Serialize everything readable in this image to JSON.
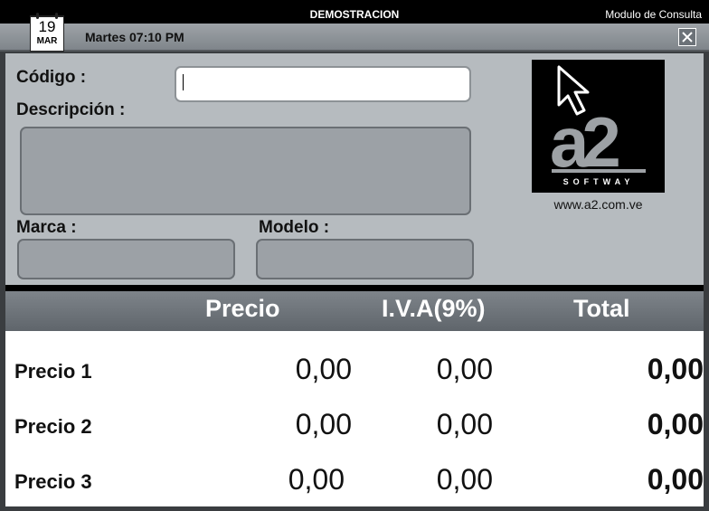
{
  "window": {
    "title": "DEMOSTRACION",
    "module": "Modulo de Consulta"
  },
  "header": {
    "calendar_day": "19",
    "calendar_month": "MAR",
    "datetime": "Martes 07:10 PM"
  },
  "form": {
    "codigo_label": "Código :",
    "codigo_value": "",
    "descripcion_label": "Descripción :",
    "descripcion_value": "",
    "marca_label": "Marca :",
    "marca_value": "",
    "modelo_label": "Modelo :",
    "modelo_value": ""
  },
  "logo": {
    "brand_mark": "a2",
    "brand_sub": "SOFTWAY",
    "website": "www.a2.com.ve"
  },
  "price_table": {
    "columns": [
      "Precio",
      "I.V.A(9%)",
      "Total"
    ],
    "rows": [
      {
        "label": "Precio 1",
        "precio": "0,00",
        "iva": "0,00",
        "total": "0,00"
      },
      {
        "label": "Precio 2",
        "precio": "0,00",
        "iva": "0,00",
        "total": "0,00"
      },
      {
        "label": "Precio 3",
        "precio": "0,00",
        "iva": "0,00",
        "total": "0,00"
      }
    ]
  }
}
